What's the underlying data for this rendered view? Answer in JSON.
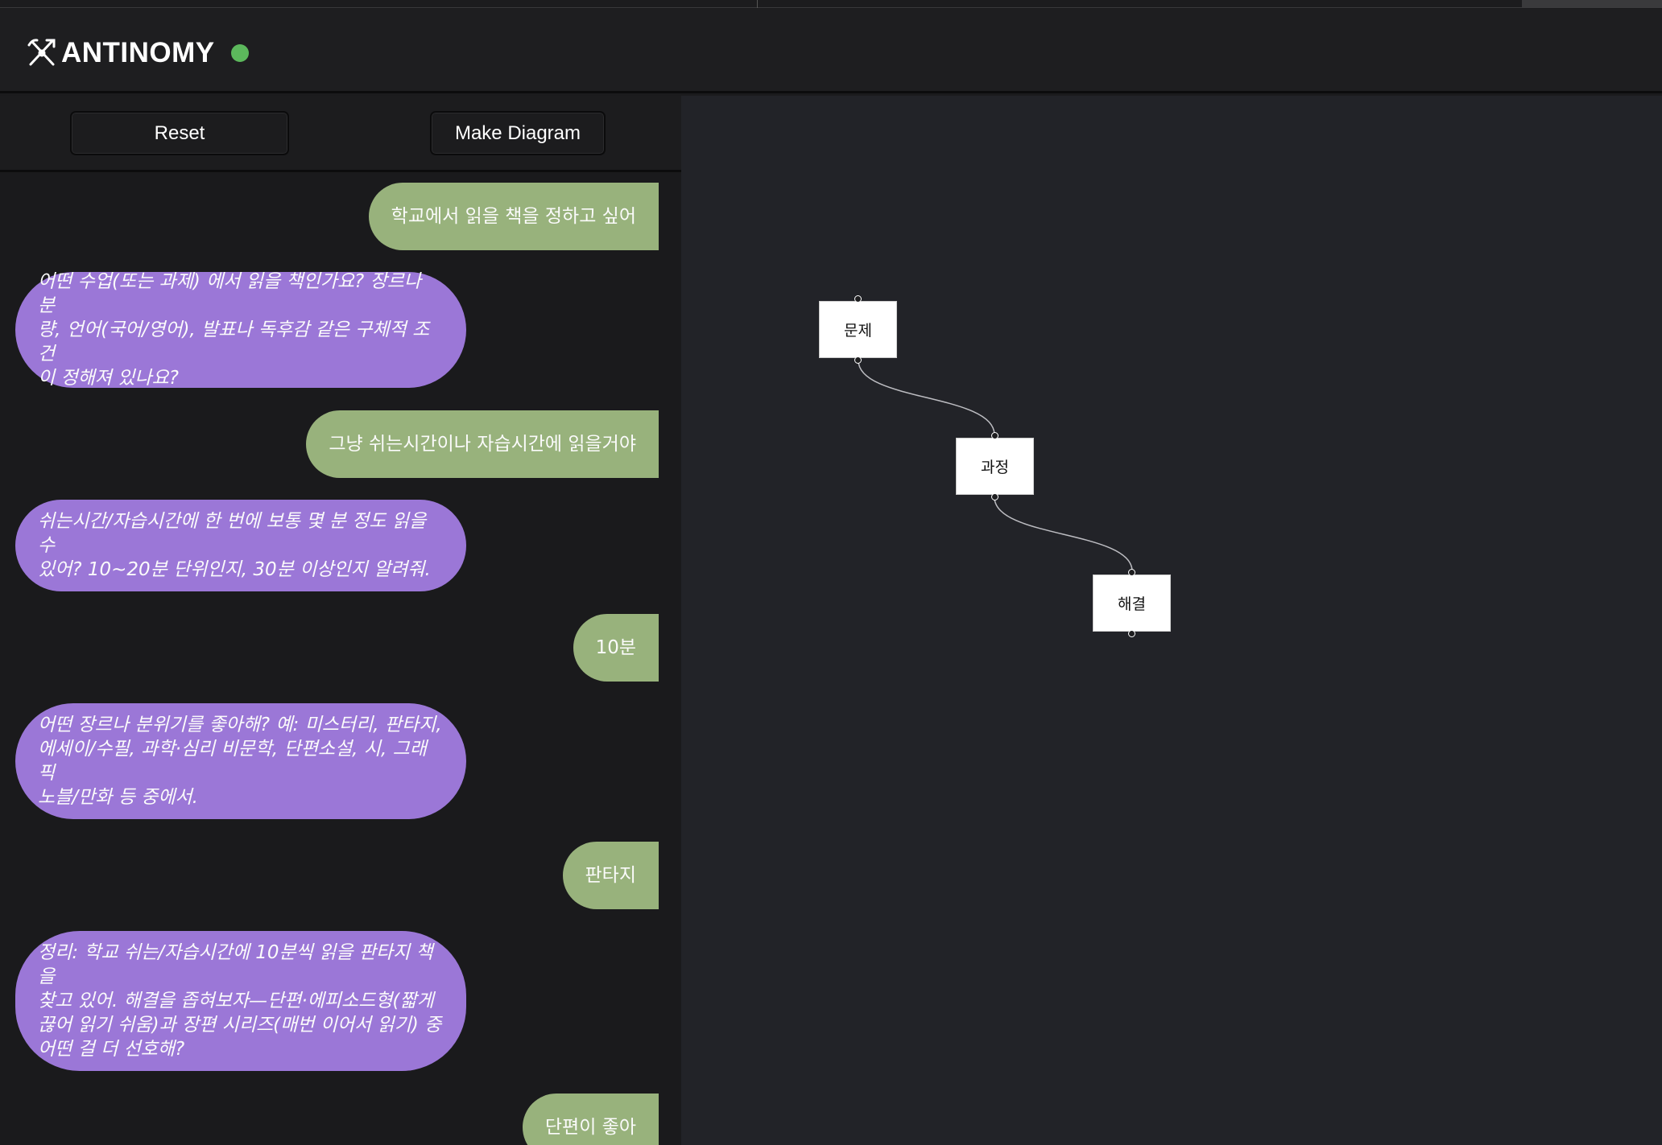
{
  "app": {
    "name": "ANTINOMY",
    "logo_icon": "crossed-tools-icon",
    "status_color": "#5cb85c"
  },
  "toolbar": {
    "reset_label": "Reset",
    "diagram_label": "Make Diagram"
  },
  "chat": {
    "messages": [
      {
        "role": "user",
        "text": "학교에서 읽을 책을 정하고 싶어"
      },
      {
        "role": "assistant",
        "lines": [
          "어떤 수업(또는 과제) 에서 읽을 책인가요? 장르나 분",
          "량, 언어(국어/영어), 발표나 독후감 같은 구체적 조건",
          "이 정해져 있나요?"
        ]
      },
      {
        "role": "user",
        "text": "그냥 쉬는시간이나 자습시간에 읽을거야"
      },
      {
        "role": "assistant",
        "lines": [
          "쉬는시간/자습시간에 한 번에 보통 몇 분 정도 읽을 수",
          "있어? 10~20분 단위인지, 30분 이상인지 알려줘."
        ]
      },
      {
        "role": "user",
        "text": "10분"
      },
      {
        "role": "assistant",
        "lines": [
          "어떤 장르나 분위기를 좋아해? 예: 미스터리, 판타지,",
          "에세이/수필, 과학·심리 비문학, 단편소설, 시, 그래픽",
          "노블/만화 등 중에서."
        ]
      },
      {
        "role": "user",
        "text": "판타지"
      },
      {
        "role": "assistant",
        "lines": [
          "정리: 학교 쉬는/자습시간에 10분씩 읽을 판타지 책을",
          "찾고 있어. 해결을 좁혀보자—단편·에피소드형(짧게",
          "끊어 읽기 쉬움)과 장편 시리즈(매번 이어서 읽기) 중",
          "어떤 걸 더 선호해?"
        ]
      },
      {
        "role": "user",
        "text": "단편이 좋아"
      }
    ]
  },
  "diagram": {
    "nodes": [
      {
        "id": "problem",
        "label": "문제"
      },
      {
        "id": "process",
        "label": "과정"
      },
      {
        "id": "solution",
        "label": "해결"
      }
    ],
    "edges": [
      {
        "from": "problem",
        "to": "process"
      },
      {
        "from": "process",
        "to": "solution"
      }
    ]
  },
  "colors": {
    "user_bubble": "#98b27c",
    "assistant_bubble": "#9b77d7",
    "canvas_bg": "#222328",
    "panel_bg": "#1a1a1c"
  }
}
